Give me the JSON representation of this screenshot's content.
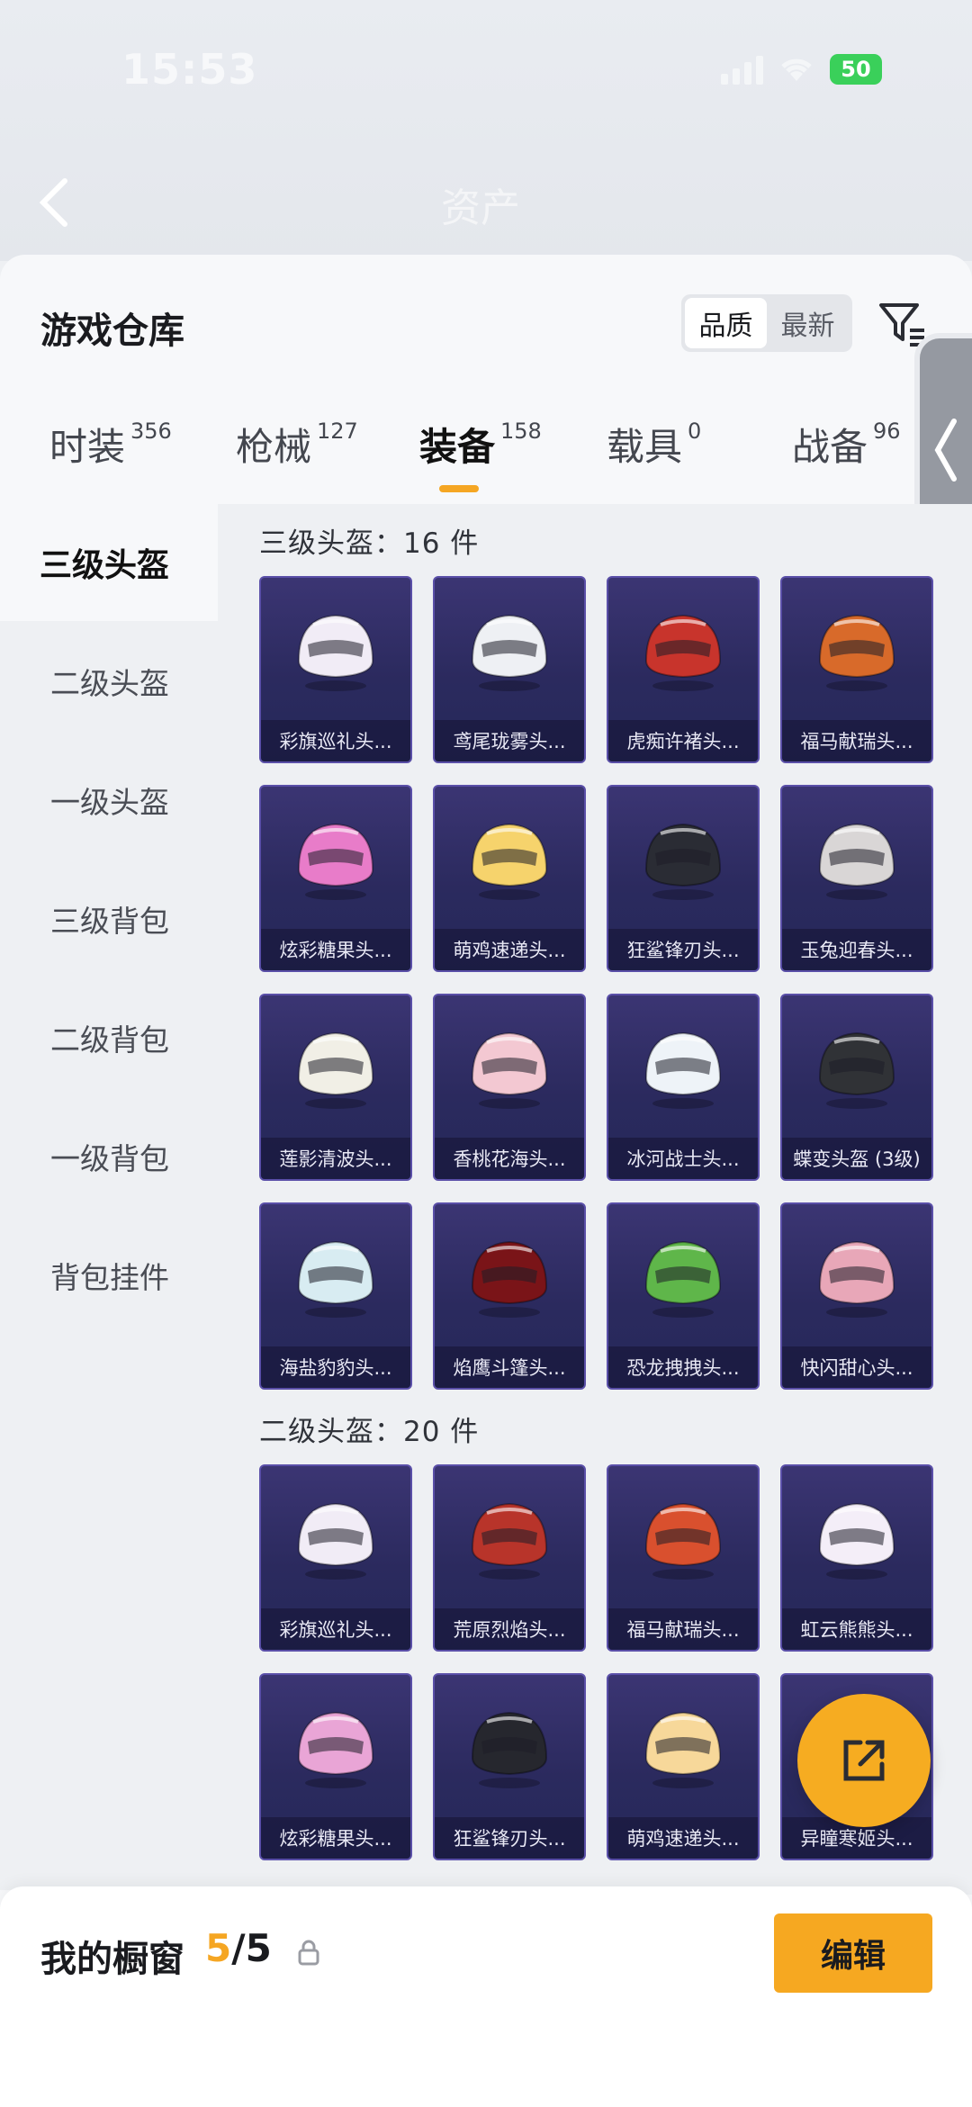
{
  "status_bar": {
    "time": "15:53",
    "battery": "50"
  },
  "header": {
    "title": "资产"
  },
  "panel": {
    "title": "游戏仓库"
  },
  "sort": {
    "options": [
      "品质",
      "最新"
    ],
    "active_index": 0
  },
  "tabs": [
    {
      "label": "时装",
      "count": "356"
    },
    {
      "label": "枪械",
      "count": "127"
    },
    {
      "label": "装备",
      "count": "158",
      "active": true
    },
    {
      "label": "载具",
      "count": "0"
    },
    {
      "label": "战备",
      "count": "96"
    }
  ],
  "categories": [
    "三级头盔",
    "二级头盔",
    "一级头盔",
    "三级背包",
    "二级背包",
    "一级背包",
    "背包挂件"
  ],
  "active_category_index": 0,
  "sections": [
    {
      "title": "三级头盔：16 件",
      "items": [
        "彩旗巡礼头...",
        "鸢尾珑雾头...",
        "虎痴许褚头...",
        "福马献瑞头...",
        "炫彩糖果头...",
        "萌鸡速递头...",
        "狂鲨锋刃头...",
        "玉兔迎春头...",
        "莲影清波头...",
        "香桃花海头...",
        "冰河战士头...",
        "蝶变头盔 (3级)",
        "海盐豹豹头...",
        "焰鹰斗篷头...",
        "恐龙拽拽头...",
        "快闪甜心头..."
      ]
    },
    {
      "title": "二级头盔：20 件",
      "items": [
        "彩旗巡礼头...",
        "荒原烈焰头...",
        "福马献瑞头...",
        "虹云熊熊头...",
        "炫彩糖果头...",
        "狂鲨锋刃头...",
        "萌鸡速递头...",
        "异瞳寒姬头..."
      ]
    }
  ],
  "helmet_colors": {
    "s0": [
      "#f1ecf6",
      "#eef0f4",
      "#c8342c",
      "#d86a2a",
      "#e87cc9",
      "#f6d36c",
      "#2a2c34",
      "#d9d6d6",
      "#f1efe6",
      "#f3c8d2",
      "#eef3f8",
      "#303236",
      "#d8ecf2",
      "#7a1418",
      "#5fb64a",
      "#e8a7b8"
    ],
    "s1": [
      "#f1ecf6",
      "#b8342a",
      "#d9502e",
      "#f4eef8",
      "#e9a5d6",
      "#26272e",
      "#f7d89a",
      "#f4dde8"
    ]
  },
  "bottom_bar": {
    "label": "我的橱窗",
    "count_current": "5",
    "count_total": "/5",
    "edit_label": "编辑"
  }
}
